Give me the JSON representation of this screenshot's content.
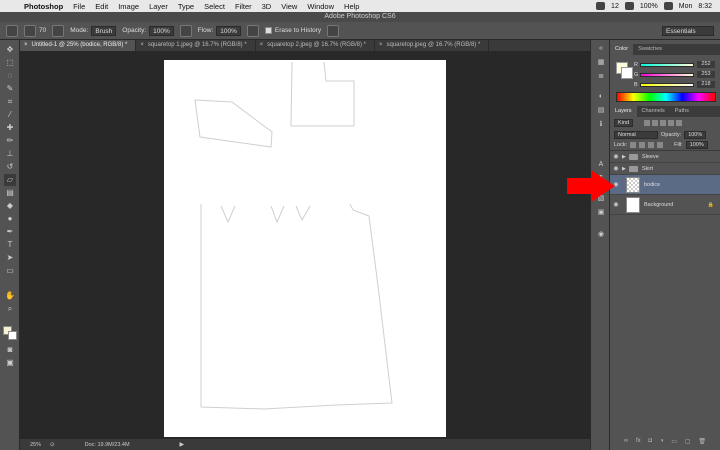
{
  "menubar": {
    "app_name": "Photoshop",
    "items": [
      "File",
      "Edit",
      "Image",
      "Layer",
      "Type",
      "Select",
      "Filter",
      "3D",
      "View",
      "Window",
      "Help"
    ],
    "tray": {
      "badge": "12",
      "battery": "100%",
      "time": "8:32",
      "name": "Mon"
    }
  },
  "window_title": "Adobe Photoshop CS6",
  "options": {
    "brush_size": "70",
    "mode_label": "Mode:",
    "mode_value": "Brush",
    "opacity_label": "Opacity:",
    "opacity_value": "100%",
    "flow_label": "Flow:",
    "flow_value": "100%",
    "erase_history": "Erase to History",
    "workspace": "Essentials"
  },
  "tabs": [
    {
      "label": "Untitled-1 @ 25% (bodice, RGB/8) *",
      "active": true
    },
    {
      "label": "squaretop 1.jpeg @ 16.7% (RGB/8) *",
      "active": false
    },
    {
      "label": "squaretop 2.jpeg @ 16.7% (RGB/8) *",
      "active": false
    },
    {
      "label": "squaretop.jpeg @ 16.7% (RGB/8) *",
      "active": false
    }
  ],
  "status": {
    "zoom": "25%",
    "doc": "Doc: 19.9M/23.4M"
  },
  "color_panel": {
    "tabs": [
      "Color",
      "Swatches"
    ],
    "sliders": [
      {
        "label": "R",
        "value": "252"
      },
      {
        "label": "G",
        "value": "253"
      },
      {
        "label": "B",
        "value": "218"
      }
    ]
  },
  "layers_panel": {
    "tabs": [
      "Layers",
      "Channels",
      "Paths"
    ],
    "kind_label": "Kind",
    "blend_mode": "Normal",
    "opacity_label": "Opacity:",
    "opacity_value": "100%",
    "lock_label": "Lock:",
    "fill_label": "Fill:",
    "fill_value": "100%",
    "layers": [
      {
        "name": "Sleeve",
        "type": "group"
      },
      {
        "name": "Skirt",
        "type": "group"
      },
      {
        "name": "bodice",
        "type": "layer",
        "selected": true
      },
      {
        "name": "Background",
        "type": "background"
      }
    ]
  },
  "colors": {
    "accent_selected": "#5b6b85",
    "arrow": "#ff0000",
    "fg_color": "#fcfdda"
  }
}
